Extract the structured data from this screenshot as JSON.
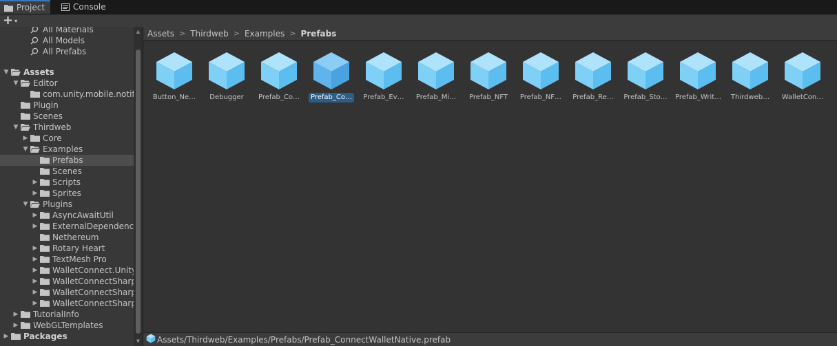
{
  "tabs": [
    {
      "label": "Project",
      "icon": "folder-icon",
      "active": true
    },
    {
      "label": "Console",
      "icon": "console-icon",
      "active": false
    }
  ],
  "toolbar": {
    "add_label": "+",
    "add_caret": "▾"
  },
  "tree": [
    {
      "label": "All Materials",
      "type": "search",
      "depth": 2,
      "arrow": ""
    },
    {
      "label": "All Models",
      "type": "search",
      "depth": 2,
      "arrow": ""
    },
    {
      "label": "All Prefabs",
      "type": "search",
      "depth": 2,
      "arrow": ""
    },
    {
      "label": "",
      "type": "spacer",
      "depth": 0,
      "arrow": ""
    },
    {
      "label": "Assets",
      "type": "folder-open",
      "depth": 0,
      "arrow": "▼",
      "bold": true
    },
    {
      "label": "Editor",
      "type": "folder-open",
      "depth": 1,
      "arrow": "▼"
    },
    {
      "label": "com.unity.mobile.notifications",
      "type": "folder",
      "depth": 2,
      "arrow": ""
    },
    {
      "label": "Plugin",
      "type": "folder",
      "depth": 1,
      "arrow": ""
    },
    {
      "label": "Scenes",
      "type": "folder",
      "depth": 1,
      "arrow": ""
    },
    {
      "label": "Thirdweb",
      "type": "folder-open",
      "depth": 1,
      "arrow": "▼"
    },
    {
      "label": "Core",
      "type": "folder",
      "depth": 2,
      "arrow": "▶"
    },
    {
      "label": "Examples",
      "type": "folder-open",
      "depth": 2,
      "arrow": "▼"
    },
    {
      "label": "Prefabs",
      "type": "folder",
      "depth": 3,
      "arrow": "",
      "selected": true
    },
    {
      "label": "Scenes",
      "type": "folder",
      "depth": 3,
      "arrow": ""
    },
    {
      "label": "Scripts",
      "type": "folder",
      "depth": 3,
      "arrow": "▶"
    },
    {
      "label": "Sprites",
      "type": "folder",
      "depth": 3,
      "arrow": "▶"
    },
    {
      "label": "Plugins",
      "type": "folder-open",
      "depth": 2,
      "arrow": "▼"
    },
    {
      "label": "AsyncAwaitUtil",
      "type": "folder",
      "depth": 3,
      "arrow": "▶"
    },
    {
      "label": "ExternalDependencyManager",
      "type": "folder",
      "depth": 3,
      "arrow": "▶"
    },
    {
      "label": "Nethereum",
      "type": "folder",
      "depth": 3,
      "arrow": ""
    },
    {
      "label": "Rotary Heart",
      "type": "folder",
      "depth": 3,
      "arrow": "▶"
    },
    {
      "label": "TextMesh Pro",
      "type": "folder",
      "depth": 3,
      "arrow": "▶"
    },
    {
      "label": "WalletConnect.Unity",
      "type": "folder",
      "depth": 3,
      "arrow": "▶"
    },
    {
      "label": "WalletConnectSharp",
      "type": "folder",
      "depth": 3,
      "arrow": "▶"
    },
    {
      "label": "WalletConnectSharp",
      "type": "folder",
      "depth": 3,
      "arrow": "▶"
    },
    {
      "label": "WalletConnectSharp",
      "type": "folder",
      "depth": 3,
      "arrow": "▶"
    },
    {
      "label": "TutorialInfo",
      "type": "folder",
      "depth": 1,
      "arrow": "▶"
    },
    {
      "label": "WebGLTemplates",
      "type": "folder",
      "depth": 1,
      "arrow": "▶"
    },
    {
      "label": "Packages",
      "type": "folder",
      "depth": 0,
      "arrow": "▶",
      "bold": true
    }
  ],
  "breadcrumb": [
    "Assets",
    "Thirdweb",
    "Examples",
    "Prefabs"
  ],
  "assets": [
    {
      "label": "Button_Ne…",
      "selected": false
    },
    {
      "label": "Debugger",
      "selected": false
    },
    {
      "label": "Prefab_Co…",
      "selected": false
    },
    {
      "label": "Prefab_Co…",
      "selected": true
    },
    {
      "label": "Prefab_Ev…",
      "selected": false
    },
    {
      "label": "Prefab_Mi…",
      "selected": false
    },
    {
      "label": "Prefab_NFT",
      "selected": false
    },
    {
      "label": "Prefab_NF…",
      "selected": false
    },
    {
      "label": "Prefab_Re…",
      "selected": false
    },
    {
      "label": "Prefab_Sto…",
      "selected": false
    },
    {
      "label": "Prefab_Writ…",
      "selected": false
    },
    {
      "label": "Thirdweb…",
      "selected": false
    },
    {
      "label": "WalletCon…",
      "selected": false
    }
  ],
  "status": {
    "path": "Assets/Thirdweb/Examples/Prefabs/Prefab_ConnectWalletNative.prefab",
    "icon": "prefab-icon"
  },
  "colors": {
    "prefab": "#7fd0f7",
    "prefab_selected": "#5fb4ee",
    "selection": "#2c5d87",
    "accent": "#3a79bb"
  }
}
